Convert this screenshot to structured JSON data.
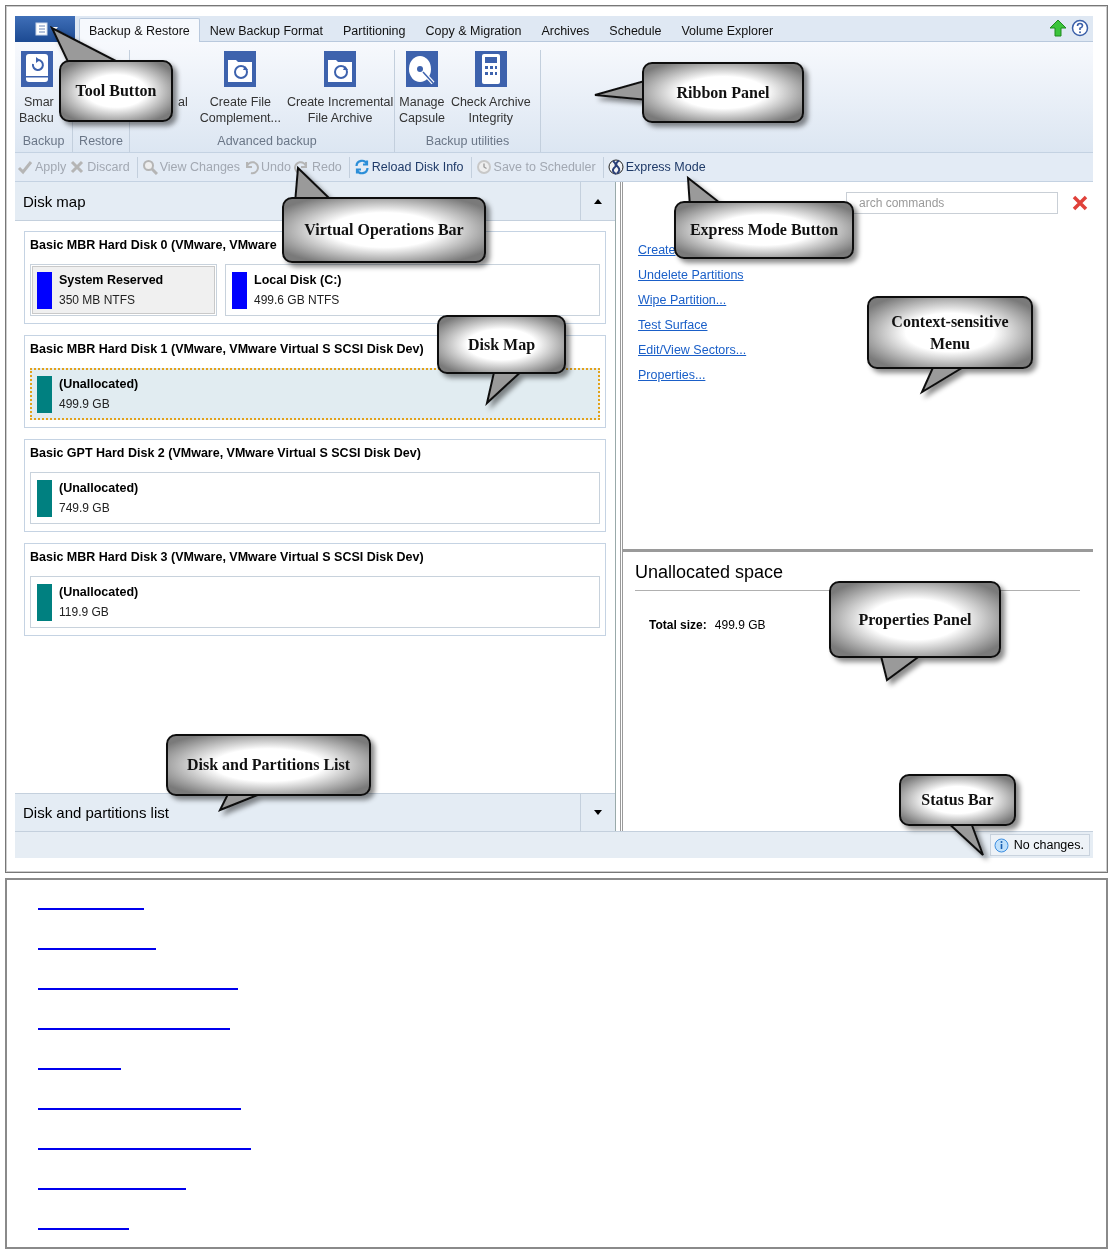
{
  "tabs": [
    {
      "label": "Backup & Restore",
      "selected": true
    },
    {
      "label": "New Backup Format",
      "selected": false
    },
    {
      "label": "Partitioning",
      "selected": false
    },
    {
      "label": "Copy & Migration",
      "selected": false
    },
    {
      "label": "Archives",
      "selected": false
    },
    {
      "label": "Schedule",
      "selected": false
    },
    {
      "label": "Volume Explorer",
      "selected": false
    }
  ],
  "ribbon_groups": [
    {
      "label": "Backup",
      "items": [
        {
          "kind": "drive",
          "lines": [
            "Smar",
            "Backu"
          ]
        }
      ]
    },
    {
      "label": "Restore"
    },
    {
      "label": "Advanced backup",
      "items": [
        {
          "kind": "covered",
          "lines": [
            "al"
          ]
        },
        {
          "kind": "folder",
          "lines": [
            "Create File",
            "Complement..."
          ]
        },
        {
          "kind": "folder",
          "lines": [
            "Create Incremental",
            "File Archive"
          ]
        }
      ]
    },
    {
      "label": "Backup utilities",
      "items": [
        {
          "kind": "disc",
          "lines": [
            "Manage",
            "Capsule"
          ]
        },
        {
          "kind": "calculator",
          "lines": [
            "Check Archive",
            "Integrity"
          ]
        }
      ]
    }
  ],
  "toolbar": [
    {
      "buttons": [
        {
          "label": "Apply",
          "kind": "check",
          "disabled": true
        },
        {
          "label": "Discard",
          "kind": "cross",
          "disabled": true
        }
      ]
    },
    {
      "buttons": [
        {
          "label": "View Changes",
          "kind": "magnifier",
          "disabled": true
        },
        {
          "label": "Undo",
          "kind": "undo",
          "disabled": true
        },
        {
          "label": "Redo",
          "kind": "redo",
          "disabled": true
        }
      ]
    },
    {
      "buttons": [
        {
          "label": "Reload Disk Info",
          "kind": "refresh",
          "disabled": false
        }
      ]
    },
    {
      "buttons": [
        {
          "label": "Save to Scheduler",
          "kind": "clock",
          "disabled": true
        }
      ]
    },
    {
      "buttons": [
        {
          "label": "Express Mode",
          "kind": "globe",
          "disabled": false
        }
      ]
    }
  ],
  "disk_map": {
    "title": "Disk map",
    "disks": [
      {
        "title": "Basic MBR Hard Disk 0 (VMware, VMware",
        "partitions": [
          {
            "name": "System Reserved",
            "size": "350 MB NTFS",
            "color": "#0000ff",
            "selected": false,
            "shaded": true
          },
          {
            "name": "Local Disk (C:)",
            "size": "499.6 GB NTFS",
            "color": "#0000ff",
            "selected": false,
            "shaded": false
          }
        ]
      },
      {
        "title": "Basic MBR Hard Disk 1 (VMware, VMware Virtual S SCSI Disk Dev)",
        "partitions": [
          {
            "name": "(Unallocated)",
            "size": "499.9 GB",
            "color": "#008080",
            "selected": true,
            "shaded": false
          }
        ]
      },
      {
        "title": "Basic GPT Hard Disk 2 (VMware, VMware Virtual S SCSI Disk Dev)",
        "partitions": [
          {
            "name": "(Unallocated)",
            "size": "749.9 GB",
            "color": "#008080",
            "selected": false,
            "shaded": false
          }
        ]
      },
      {
        "title": "Basic MBR Hard Disk 3 (VMware, VMware Virtual S SCSI Disk Dev)",
        "partitions": [
          {
            "name": "(Unallocated)",
            "size": "119.9 GB",
            "color": "#008080",
            "selected": false,
            "shaded": false
          }
        ]
      }
    ]
  },
  "disk_list": {
    "title": "Disk and partitions list"
  },
  "search": {
    "placeholder": "arch commands"
  },
  "commands": [
    {
      "label": "Create"
    },
    {
      "label": "Undelete Partitions"
    },
    {
      "label": "Wipe Partition..."
    },
    {
      "label": "Test Surface"
    },
    {
      "label": "Edit/View Sectors..."
    },
    {
      "label": "Properties..."
    }
  ],
  "properties": {
    "title": "Unallocated space",
    "rows": [
      {
        "label": "Total size:",
        "value": "499.9 GB"
      }
    ]
  },
  "status_bar": {
    "text": "No changes."
  },
  "callouts": [
    {
      "label": "Tool Button"
    },
    {
      "label": "Ribbon Panel"
    },
    {
      "label": "Virtual Operations Bar"
    },
    {
      "label": "Express Mode Button"
    },
    {
      "label": "Disk Map"
    },
    {
      "label": "Context-sensitive Menu"
    },
    {
      "label": "Properties Panel"
    },
    {
      "label": "Disk and Partitions List"
    },
    {
      "label": "Status Bar"
    }
  ]
}
